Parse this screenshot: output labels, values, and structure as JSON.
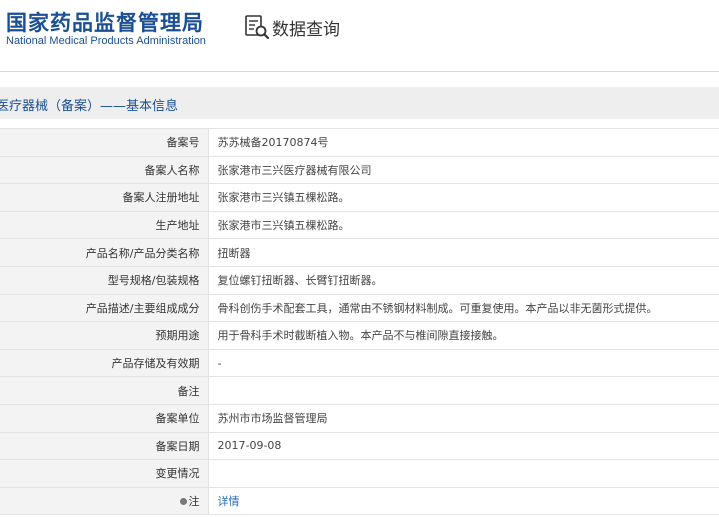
{
  "header": {
    "org_name_cn": "国家药品监督管理局",
    "org_name_en": "National Medical Products Administration",
    "query_label": "数据查询",
    "query_icon": "document-search-icon"
  },
  "section": {
    "title": "医疗器械（备案）——基本信息"
  },
  "rows": [
    {
      "label": "备案号",
      "value": "苏苏械备20170874号"
    },
    {
      "label": "备案人名称",
      "value": "张家港市三兴医疗器械有限公司"
    },
    {
      "label": "备案人注册地址",
      "value": "张家港市三兴镇五棵松路。"
    },
    {
      "label": "生产地址",
      "value": "张家港市三兴镇五棵松路。"
    },
    {
      "label": "产品名称/产品分类名称",
      "value": "扭断器"
    },
    {
      "label": "型号规格/包装规格",
      "value": "复位螺钉扭断器、长臂钉扭断器。"
    },
    {
      "label": "产品描述/主要组成成分",
      "value": "骨科创伤手术配套工具，通常由不锈钢材料制成。可重复使用。本产品以非无菌形式提供。"
    },
    {
      "label": "预期用途",
      "value": "用于骨科手术时截断植入物。本产品不与椎间隙直接接触。"
    },
    {
      "label": "产品存储及有效期",
      "value": "-"
    },
    {
      "label": "备注",
      "value": ""
    },
    {
      "label": "备案单位",
      "value": "苏州市市场监督管理局"
    },
    {
      "label": "备案日期",
      "value": "2017-09-08"
    },
    {
      "label": "变更情况",
      "value": ""
    },
    {
      "label": "注",
      "value": "详情"
    }
  ]
}
